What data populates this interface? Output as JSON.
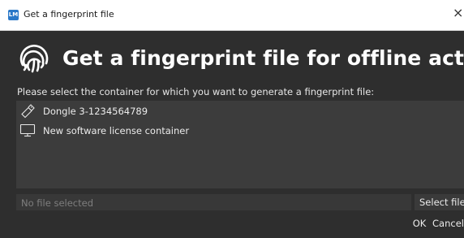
{
  "window": {
    "title": "Get a fingerprint file",
    "app_icon_text": "LM",
    "close_glyph": "×"
  },
  "header": {
    "icon": "fingerprint-icon",
    "title": "Get a fingerprint file for offline activation"
  },
  "instruction": "Please select the container for which you want to generate a fingerprint file:",
  "containers": [
    {
      "icon": "usb-dongle-icon",
      "label": "Dongle 3-1234564789"
    },
    {
      "icon": "monitor-icon",
      "label": "New software license container"
    }
  ],
  "file_picker": {
    "placeholder": "No file selected",
    "button_label": "Select file"
  },
  "dialog_buttons": {
    "ok": "OK",
    "cancel": "Cancel"
  },
  "colors": {
    "background": "#2e2e2e",
    "list_background": "#3c3c3c",
    "text": "#ececec",
    "title_bar": "#ffffff"
  }
}
